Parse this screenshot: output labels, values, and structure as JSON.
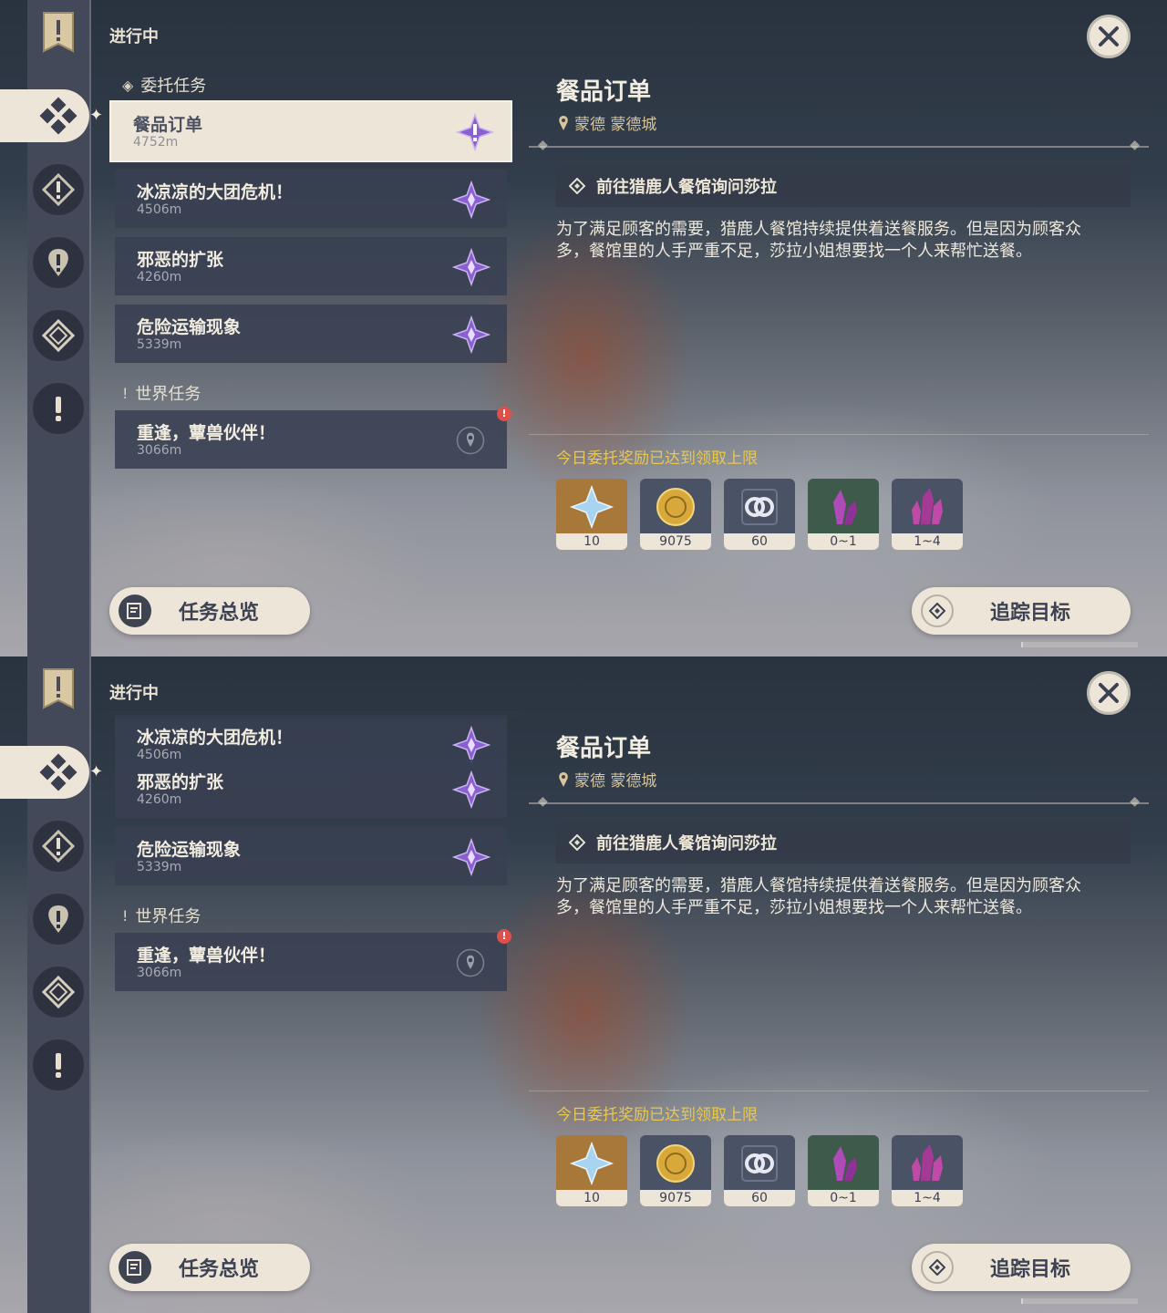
{
  "screens": [
    {
      "section_title": "进行中",
      "categories": {
        "commission": "委托任务",
        "world": "世界任务"
      },
      "quests": [
        {
          "name": "餐品订单",
          "distance": "4752m"
        },
        {
          "name": "冰凉凉的大团危机！",
          "distance": "4506m"
        },
        {
          "name": "邪恶的扩张",
          "distance": "4260m"
        },
        {
          "name": "危险运输现象",
          "distance": "5339m"
        },
        {
          "name": "重逢，蕈兽伙伴！",
          "distance": "3066m"
        }
      ],
      "detail": {
        "title": "餐品订单",
        "location": "蒙德 蒙德城",
        "objective": "前往猎鹿人餐馆询问莎拉",
        "description_1": "为了满足顾客的需要，猎鹿人餐馆持续提供着送餐服务。但是因为顾客众",
        "description_2": "多，餐馆里的人手严重不足，莎拉小姐想要找一个人来帮忙送餐。",
        "reward_limit": "今日委托奖励已达到领取上限",
        "rewards": [
          {
            "icon": "primogem-icon",
            "count": "10"
          },
          {
            "icon": "mora-icon",
            "count": "9075"
          },
          {
            "icon": "friendship-exp-icon",
            "count": "60"
          },
          {
            "icon": "crystal-chunk-icon",
            "count": "0~1"
          },
          {
            "icon": "crystal-cluster-icon",
            "count": "1~4"
          }
        ]
      },
      "buttons": {
        "overview": "任务总览",
        "track": "追踪目标"
      },
      "alert_mark": "!"
    },
    {
      "section_title": "进行中",
      "categories": {
        "world": "世界任务"
      },
      "quests": [
        {
          "name": "冰凉凉的大团危机！",
          "distance": "4506m"
        },
        {
          "name": "邪恶的扩张",
          "distance": "4260m"
        },
        {
          "name": "危险运输现象",
          "distance": "5339m"
        },
        {
          "name": "重逢，蕈兽伙伴！",
          "distance": "3066m"
        }
      ],
      "detail": {
        "title": "餐品订单",
        "location": "蒙德 蒙德城",
        "objective": "前往猎鹿人餐馆询问莎拉",
        "description_1": "为了满足顾客的需要，猎鹿人餐馆持续提供着送餐服务。但是因为顾客众",
        "description_2": "多，餐馆里的人手严重不足，莎拉小姐想要找一个人来帮忙送餐。",
        "reward_limit": "今日委托奖励已达到领取上限",
        "rewards": [
          {
            "icon": "primogem-icon",
            "count": "10"
          },
          {
            "icon": "mora-icon",
            "count": "9075"
          },
          {
            "icon": "friendship-exp-icon",
            "count": "60"
          },
          {
            "icon": "crystal-chunk-icon",
            "count": "0~1"
          },
          {
            "icon": "crystal-cluster-icon",
            "count": "1~4"
          }
        ]
      },
      "buttons": {
        "overview": "任务总览",
        "track": "追踪目标"
      },
      "alert_mark": "!"
    }
  ],
  "colors": {
    "accent_cream": "#ece5d8",
    "panel_dark": "#384052",
    "limit_yellow": "#e9c84c",
    "commission_purple": "#8a5fd0",
    "alert_red": "#e0504a"
  }
}
